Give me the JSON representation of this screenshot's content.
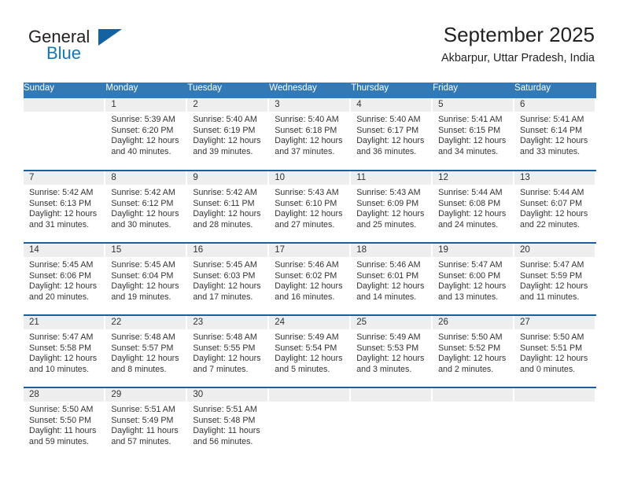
{
  "brand": {
    "name_part1": "General",
    "name_part2": "Blue",
    "logo_icon": "triangle-logo-icon"
  },
  "header": {
    "title": "September 2025",
    "subtitle": "Akbarpur, Uttar Pradesh, India"
  },
  "colors": {
    "header_blue": "#3379b5",
    "row_border_blue": "#1a5f9e",
    "daynum_band": "#eeeeee",
    "brand_blue": "#1276bd",
    "text": "#333333"
  },
  "calendar": {
    "day_headers": [
      "Sunday",
      "Monday",
      "Tuesday",
      "Wednesday",
      "Thursday",
      "Friday",
      "Saturday"
    ],
    "labels": {
      "sunrise": "Sunrise:",
      "sunset": "Sunset:",
      "daylight": "Daylight:"
    },
    "weeks": [
      [
        {
          "day": "",
          "line1": "",
          "line2": "",
          "line3": "",
          "line4": ""
        },
        {
          "day": "1",
          "line1": "Sunrise: 5:39 AM",
          "line2": "Sunset: 6:20 PM",
          "line3": "Daylight: 12 hours",
          "line4": "and 40 minutes."
        },
        {
          "day": "2",
          "line1": "Sunrise: 5:40 AM",
          "line2": "Sunset: 6:19 PM",
          "line3": "Daylight: 12 hours",
          "line4": "and 39 minutes."
        },
        {
          "day": "3",
          "line1": "Sunrise: 5:40 AM",
          "line2": "Sunset: 6:18 PM",
          "line3": "Daylight: 12 hours",
          "line4": "and 37 minutes."
        },
        {
          "day": "4",
          "line1": "Sunrise: 5:40 AM",
          "line2": "Sunset: 6:17 PM",
          "line3": "Daylight: 12 hours",
          "line4": "and 36 minutes."
        },
        {
          "day": "5",
          "line1": "Sunrise: 5:41 AM",
          "line2": "Sunset: 6:15 PM",
          "line3": "Daylight: 12 hours",
          "line4": "and 34 minutes."
        },
        {
          "day": "6",
          "line1": "Sunrise: 5:41 AM",
          "line2": "Sunset: 6:14 PM",
          "line3": "Daylight: 12 hours",
          "line4": "and 33 minutes."
        }
      ],
      [
        {
          "day": "7",
          "line1": "Sunrise: 5:42 AM",
          "line2": "Sunset: 6:13 PM",
          "line3": "Daylight: 12 hours",
          "line4": "and 31 minutes."
        },
        {
          "day": "8",
          "line1": "Sunrise: 5:42 AM",
          "line2": "Sunset: 6:12 PM",
          "line3": "Daylight: 12 hours",
          "line4": "and 30 minutes."
        },
        {
          "day": "9",
          "line1": "Sunrise: 5:42 AM",
          "line2": "Sunset: 6:11 PM",
          "line3": "Daylight: 12 hours",
          "line4": "and 28 minutes."
        },
        {
          "day": "10",
          "line1": "Sunrise: 5:43 AM",
          "line2": "Sunset: 6:10 PM",
          "line3": "Daylight: 12 hours",
          "line4": "and 27 minutes."
        },
        {
          "day": "11",
          "line1": "Sunrise: 5:43 AM",
          "line2": "Sunset: 6:09 PM",
          "line3": "Daylight: 12 hours",
          "line4": "and 25 minutes."
        },
        {
          "day": "12",
          "line1": "Sunrise: 5:44 AM",
          "line2": "Sunset: 6:08 PM",
          "line3": "Daylight: 12 hours",
          "line4": "and 24 minutes."
        },
        {
          "day": "13",
          "line1": "Sunrise: 5:44 AM",
          "line2": "Sunset: 6:07 PM",
          "line3": "Daylight: 12 hours",
          "line4": "and 22 minutes."
        }
      ],
      [
        {
          "day": "14",
          "line1": "Sunrise: 5:45 AM",
          "line2": "Sunset: 6:06 PM",
          "line3": "Daylight: 12 hours",
          "line4": "and 20 minutes."
        },
        {
          "day": "15",
          "line1": "Sunrise: 5:45 AM",
          "line2": "Sunset: 6:04 PM",
          "line3": "Daylight: 12 hours",
          "line4": "and 19 minutes."
        },
        {
          "day": "16",
          "line1": "Sunrise: 5:45 AM",
          "line2": "Sunset: 6:03 PM",
          "line3": "Daylight: 12 hours",
          "line4": "and 17 minutes."
        },
        {
          "day": "17",
          "line1": "Sunrise: 5:46 AM",
          "line2": "Sunset: 6:02 PM",
          "line3": "Daylight: 12 hours",
          "line4": "and 16 minutes."
        },
        {
          "day": "18",
          "line1": "Sunrise: 5:46 AM",
          "line2": "Sunset: 6:01 PM",
          "line3": "Daylight: 12 hours",
          "line4": "and 14 minutes."
        },
        {
          "day": "19",
          "line1": "Sunrise: 5:47 AM",
          "line2": "Sunset: 6:00 PM",
          "line3": "Daylight: 12 hours",
          "line4": "and 13 minutes."
        },
        {
          "day": "20",
          "line1": "Sunrise: 5:47 AM",
          "line2": "Sunset: 5:59 PM",
          "line3": "Daylight: 12 hours",
          "line4": "and 11 minutes."
        }
      ],
      [
        {
          "day": "21",
          "line1": "Sunrise: 5:47 AM",
          "line2": "Sunset: 5:58 PM",
          "line3": "Daylight: 12 hours",
          "line4": "and 10 minutes."
        },
        {
          "day": "22",
          "line1": "Sunrise: 5:48 AM",
          "line2": "Sunset: 5:57 PM",
          "line3": "Daylight: 12 hours",
          "line4": "and 8 minutes."
        },
        {
          "day": "23",
          "line1": "Sunrise: 5:48 AM",
          "line2": "Sunset: 5:55 PM",
          "line3": "Daylight: 12 hours",
          "line4": "and 7 minutes."
        },
        {
          "day": "24",
          "line1": "Sunrise: 5:49 AM",
          "line2": "Sunset: 5:54 PM",
          "line3": "Daylight: 12 hours",
          "line4": "and 5 minutes."
        },
        {
          "day": "25",
          "line1": "Sunrise: 5:49 AM",
          "line2": "Sunset: 5:53 PM",
          "line3": "Daylight: 12 hours",
          "line4": "and 3 minutes."
        },
        {
          "day": "26",
          "line1": "Sunrise: 5:50 AM",
          "line2": "Sunset: 5:52 PM",
          "line3": "Daylight: 12 hours",
          "line4": "and 2 minutes."
        },
        {
          "day": "27",
          "line1": "Sunrise: 5:50 AM",
          "line2": "Sunset: 5:51 PM",
          "line3": "Daylight: 12 hours",
          "line4": "and 0 minutes."
        }
      ],
      [
        {
          "day": "28",
          "line1": "Sunrise: 5:50 AM",
          "line2": "Sunset: 5:50 PM",
          "line3": "Daylight: 11 hours",
          "line4": "and 59 minutes."
        },
        {
          "day": "29",
          "line1": "Sunrise: 5:51 AM",
          "line2": "Sunset: 5:49 PM",
          "line3": "Daylight: 11 hours",
          "line4": "and 57 minutes."
        },
        {
          "day": "30",
          "line1": "Sunrise: 5:51 AM",
          "line2": "Sunset: 5:48 PM",
          "line3": "Daylight: 11 hours",
          "line4": "and 56 minutes."
        },
        {
          "day": "",
          "line1": "",
          "line2": "",
          "line3": "",
          "line4": ""
        },
        {
          "day": "",
          "line1": "",
          "line2": "",
          "line3": "",
          "line4": ""
        },
        {
          "day": "",
          "line1": "",
          "line2": "",
          "line3": "",
          "line4": ""
        },
        {
          "day": "",
          "line1": "",
          "line2": "",
          "line3": "",
          "line4": ""
        }
      ]
    ]
  }
}
